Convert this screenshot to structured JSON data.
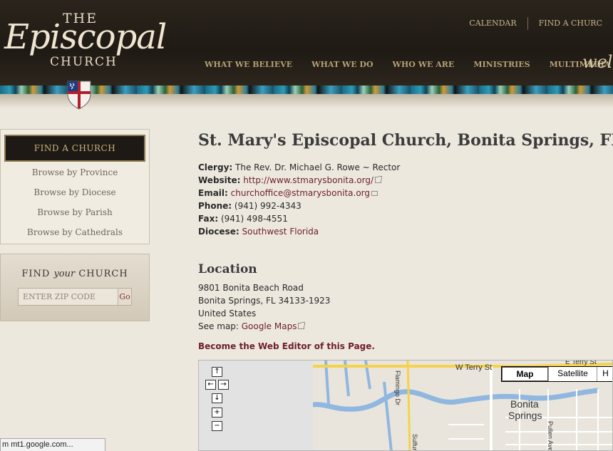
{
  "header": {
    "logo": {
      "the": "THE",
      "episcopal": "Episcopal",
      "church": "CHURCH"
    },
    "top_links": [
      "CALENDAR",
      "FIND A CHURC"
    ],
    "nav": [
      "WHAT WE BELIEVE",
      "WHAT WE DO",
      "WHO WE ARE",
      "MINISTRIES",
      "MULTIMEDIA"
    ],
    "welcome": "welc"
  },
  "sidebar": {
    "find_header": "FIND A CHURCH",
    "links": [
      "Browse by Province",
      "Browse by Diocese",
      "Browse by Parish",
      "Browse by Cathedrals"
    ],
    "zip": {
      "title_pre": "FIND",
      "title_em": "your",
      "title_post": "CHURCH",
      "placeholder": "ENTER ZIP CODE",
      "go": "Go"
    }
  },
  "church": {
    "title": "St. Mary's Episcopal Church, Bonita Springs, FL",
    "clergy_label": "Clergy:",
    "clergy": "The Rev. Dr. Michael G. Rowe ~ Rector",
    "website_label": "Website:",
    "website": "http://www.stmarysbonita.org/",
    "email_label": "Email:",
    "email": "churchoffice@stmarysbonita.org",
    "phone_label": "Phone:",
    "phone": "(941) 992-4343",
    "fax_label": "Fax:",
    "fax": "(941) 498-4551",
    "diocese_label": "Diocese:",
    "diocese": "Southwest Florida"
  },
  "location": {
    "title": "Location",
    "street": "9801 Bonita Beach Road",
    "city": "Bonita Springs, FL 34133-1923",
    "country": "United States",
    "see_map_label": "See map:",
    "map_link": "Google Maps"
  },
  "web_editor": "Become the Web Editor of this Page.",
  "map": {
    "controls": {
      "pan_up": "↑",
      "pan_left": "←",
      "pan_right": "→",
      "pan_down": "↓",
      "zoom_in": "+",
      "zoom_out": "−"
    },
    "types": [
      "Map",
      "Satellite",
      "H"
    ],
    "labels": {
      "w_terry": "W Terry St",
      "e_terry": "E Terry St",
      "city_line1": "Bonita",
      "city_line2": "Springs",
      "flamingo": "Flamingo Dr",
      "pullen": "Pullen Ave",
      "sulfur": "Sulfur"
    }
  },
  "status": "m mt1.google.com...",
  "colors": {
    "link": "#6e1e2e",
    "header_bg": "#1f1a14",
    "nav_gold": "#b59f74"
  }
}
